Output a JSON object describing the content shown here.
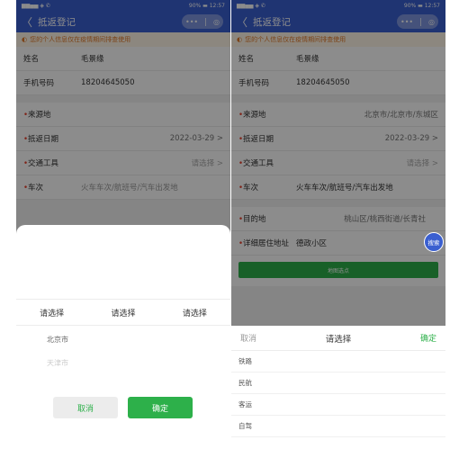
{
  "status": {
    "signal": "▆▆▅▅ ◈ ✆",
    "battery": "90%",
    "time_left": "12:57",
    "time_right": "12:57"
  },
  "nav": {
    "back": "〈",
    "title": "抵返登记",
    "more": "•••",
    "target": "◎"
  },
  "notice": "您的个人信息仅在疫情期间排查使用",
  "left": {
    "name_label": "姓名",
    "name_value": "毛景缘",
    "phone_label": "手机号码",
    "phone_value": "18204645050",
    "origin_label": "来源地",
    "date_label": "抵返日期",
    "date_value": "2022-03-29 >",
    "transport_label": "交通工具",
    "transport_value": "请选择 >",
    "train_label": "车次",
    "train_placeholder": "火车车次/航班号/汽车出发地",
    "picker": {
      "cols": [
        "请选择",
        "请选择",
        "请选择"
      ],
      "opt1": "北京市",
      "opt2": "天津市",
      "cancel": "取消",
      "ok": "确定"
    }
  },
  "right": {
    "name_label": "姓名",
    "name_value": "毛景缘",
    "phone_label": "手机号码",
    "phone_value": "18204645050",
    "origin_label": "来源地",
    "origin_value": "北京市/北京市/东城区",
    "date_label": "抵返日期",
    "date_value": "2022-03-29 >",
    "transport_label": "交通工具",
    "transport_value": "请选择 >",
    "train_label": "车次",
    "train_placeholder": "火车车次/航班号/汽车出发地",
    "dest_label": "目的地",
    "dest_value": "桃山区/桃西街道/长青社",
    "search": "搜索",
    "addr_label": "详细居住地址",
    "addr_value": "德政小区",
    "map_button": "地图选点",
    "picker": {
      "cancel": "取消",
      "title": "请选择",
      "ok": "确定",
      "items": [
        "铁路",
        "民航",
        "客运",
        "自驾"
      ]
    }
  }
}
